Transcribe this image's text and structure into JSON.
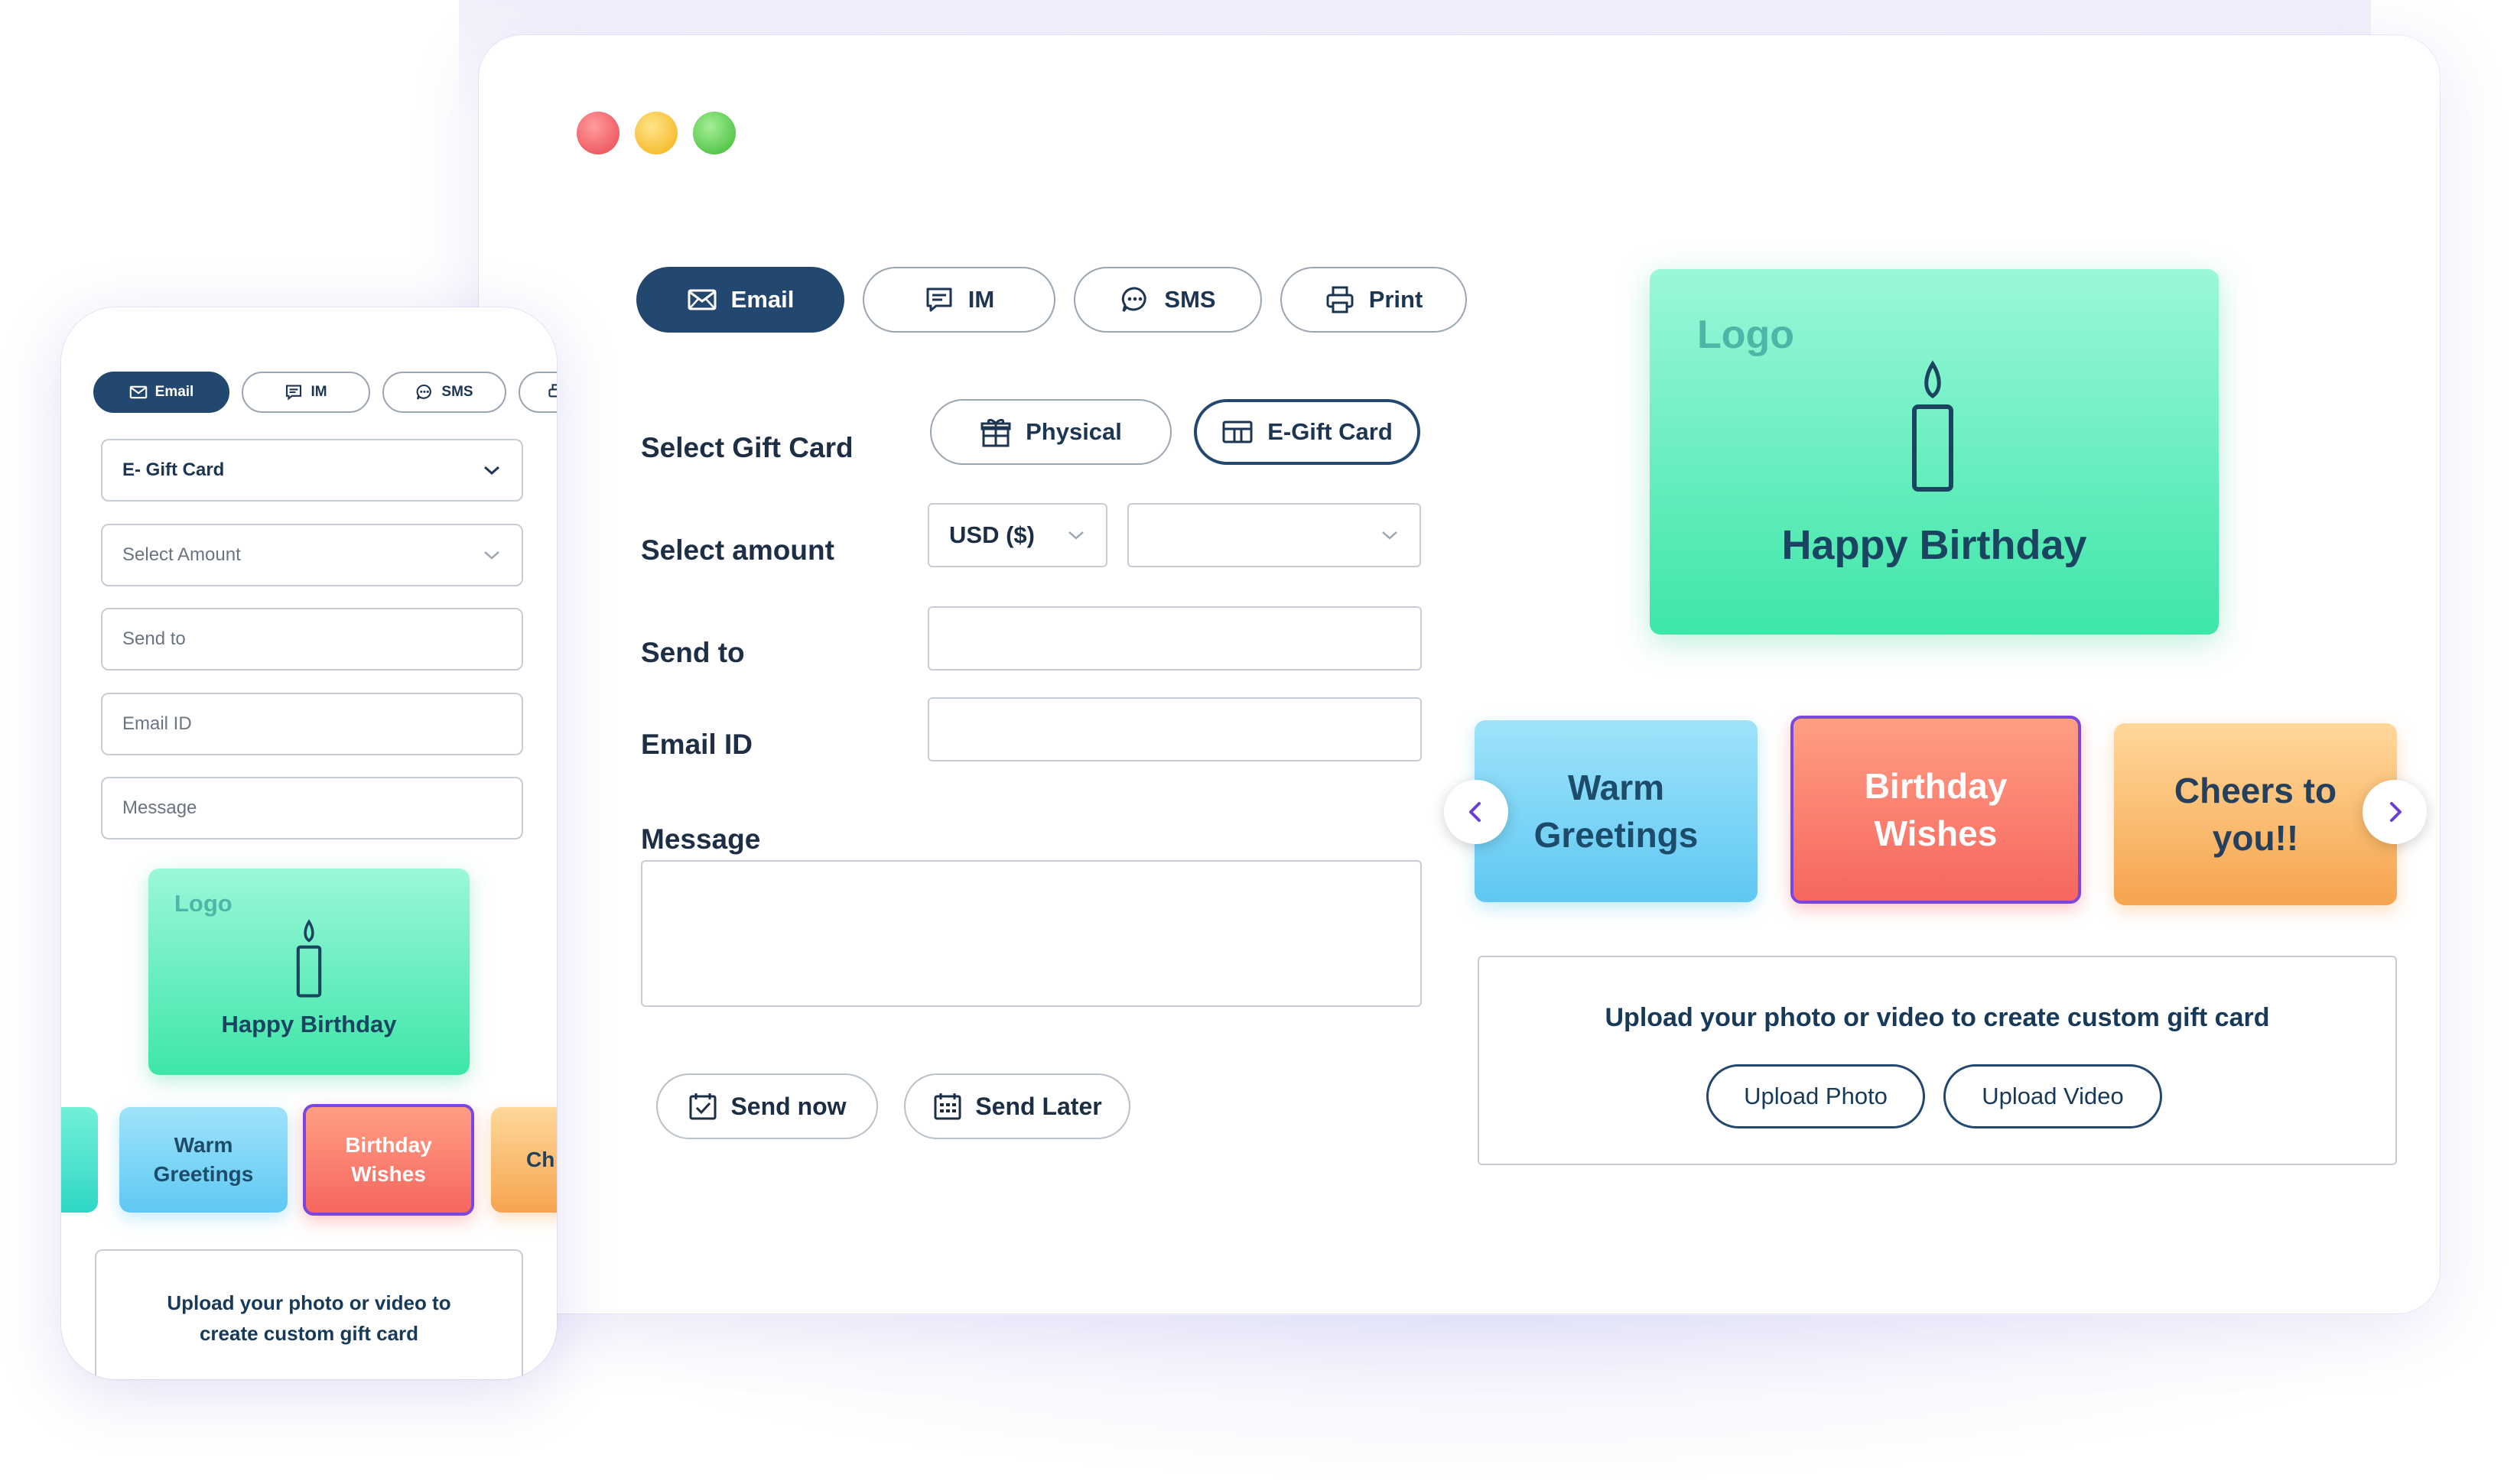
{
  "desktop": {
    "tabs": [
      {
        "label": "Email",
        "icon": "envelope-icon"
      },
      {
        "label": "IM",
        "icon": "chat-icon"
      },
      {
        "label": "SMS",
        "icon": "sms-icon"
      },
      {
        "label": "Print",
        "icon": "printer-icon"
      }
    ],
    "form": {
      "select_gift_card_label": "Select Gift Card",
      "physical_label": "Physical",
      "egift_label": "E-Gift Card",
      "select_amount_label": "Select amount",
      "currency_value": "USD ($)",
      "amount_value": "",
      "send_to_label": "Send to",
      "send_to_value": "",
      "email_label": "Email ID",
      "email_value": "",
      "message_label": "Message",
      "message_value": "",
      "send_now_label": "Send now",
      "send_later_label": "Send Later"
    },
    "preview": {
      "logo": "Logo",
      "title": "Happy Birthday"
    },
    "themes": {
      "warm": "Warm\nGreetings",
      "birthday": "Birthday\nWishes",
      "cheers": "Cheers to\nyou!!"
    },
    "upload": {
      "text": "Upload your photo or video to create custom gift card",
      "photo_label": "Upload Photo",
      "video_label": "Upload Video"
    }
  },
  "mobile": {
    "tabs": [
      {
        "label": "Email"
      },
      {
        "label": "IM"
      },
      {
        "label": "SMS"
      }
    ],
    "gift_card_select": "E- Gift Card",
    "amount_placeholder": "Select Amount",
    "send_to_placeholder": "Send to",
    "email_placeholder": "Email ID",
    "message_placeholder": "Message",
    "preview": {
      "logo": "Logo",
      "title": "Happy Birthday"
    },
    "themes": {
      "warm": "Warm\nGreetings",
      "birthday": "Birthday\nWishes",
      "cheers_partial": "Ch"
    },
    "upload_text": "Upload your photo or video to\ncreate custom gift card"
  },
  "colors": {
    "primary_navy": "#23486f",
    "card_green": "#3ee6a8",
    "tile_blue": "#5fc8f3",
    "tile_red": "#f6665e",
    "tile_orange": "#f6a44f",
    "selected_outline": "#7a47e0"
  }
}
